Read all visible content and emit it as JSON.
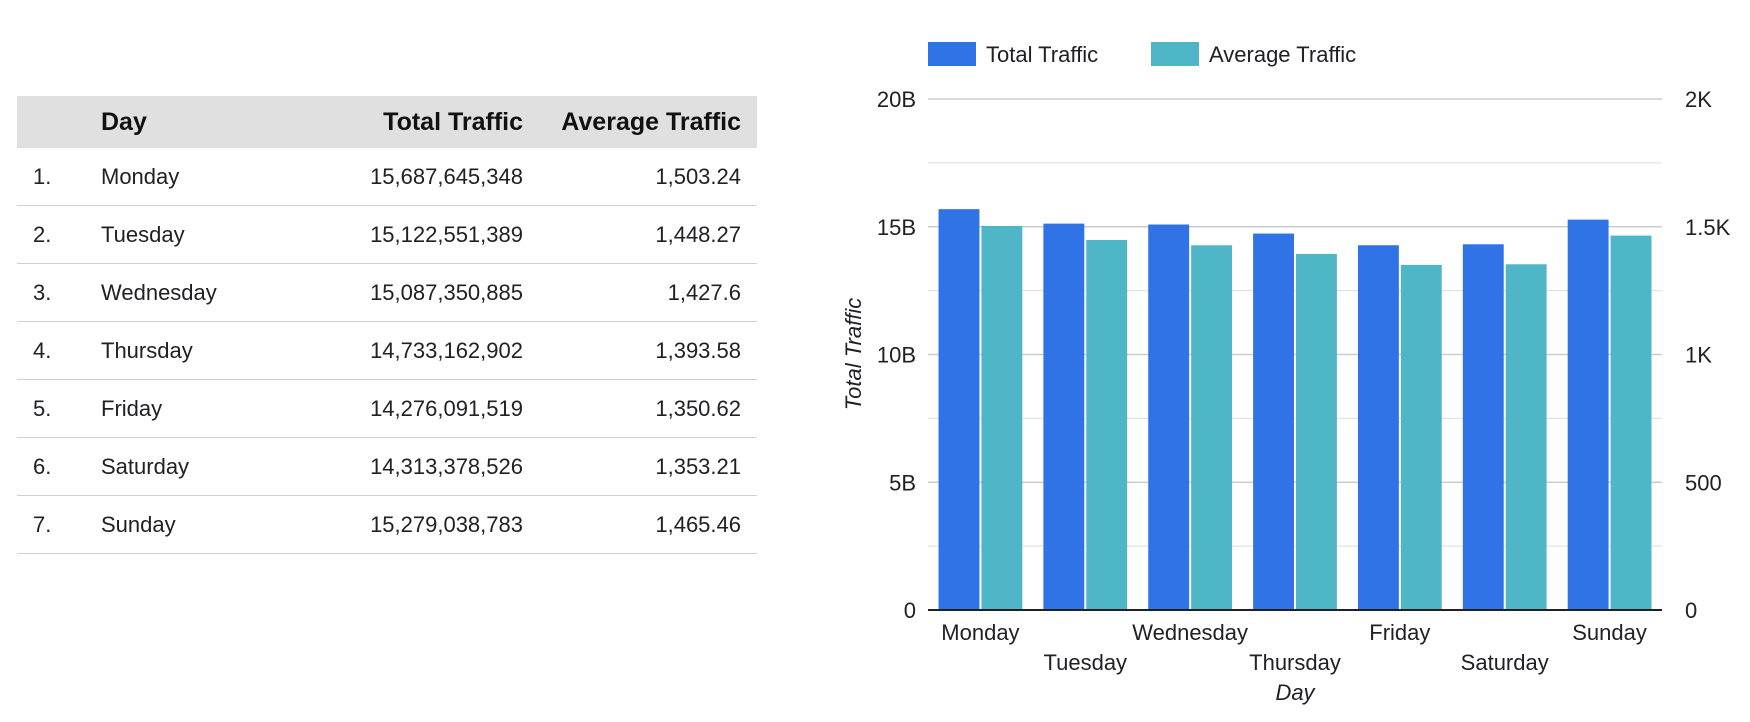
{
  "table": {
    "headers": {
      "index": "",
      "day": "Day",
      "total": "Total Traffic",
      "average": "Average Traffic"
    },
    "rows": [
      {
        "index": "1.",
        "day": "Monday",
        "total": "15,687,645,348",
        "average": "1,503.24"
      },
      {
        "index": "2.",
        "day": "Tuesday",
        "total": "15,122,551,389",
        "average": "1,448.27"
      },
      {
        "index": "3.",
        "day": "Wednesday",
        "total": "15,087,350,885",
        "average": "1,427.6"
      },
      {
        "index": "4.",
        "day": "Thursday",
        "total": "14,733,162,902",
        "average": "1,393.58"
      },
      {
        "index": "5.",
        "day": "Friday",
        "total": "14,276,091,519",
        "average": "1,350.62"
      },
      {
        "index": "6.",
        "day": "Saturday",
        "total": "14,313,378,526",
        "average": "1,353.21"
      },
      {
        "index": "7.",
        "day": "Sunday",
        "total": "15,279,038,783",
        "average": "1,465.46"
      }
    ]
  },
  "chart_data": {
    "type": "bar",
    "categories": [
      "Monday",
      "Tuesday",
      "Wednesday",
      "Thursday",
      "Friday",
      "Saturday",
      "Sunday"
    ],
    "series": [
      {
        "name": "Total Traffic",
        "axis": "left",
        "color": "#2f73e6",
        "values": [
          15687645348,
          15122551389,
          15087350885,
          14733162902,
          14276091519,
          14313378526,
          15279038783
        ]
      },
      {
        "name": "Average Traffic",
        "axis": "right",
        "color": "#4fb6c8",
        "values": [
          1503.24,
          1448.27,
          1427.6,
          1393.58,
          1350.62,
          1353.21,
          1465.46
        ]
      }
    ],
    "xlabel": "Day",
    "ylabel": "Total Traffic",
    "y_left": {
      "min": 0,
      "max": 20000000000,
      "ticks": [
        0,
        5000000000,
        10000000000,
        15000000000,
        20000000000
      ],
      "tick_labels": [
        "0",
        "5B",
        "10B",
        "15B",
        "20B"
      ]
    },
    "y_right": {
      "min": 0,
      "max": 2000,
      "ticks": [
        0,
        500,
        1000,
        1500,
        2000
      ],
      "tick_labels": [
        "0",
        "500",
        "1K",
        "1.5K",
        "2K"
      ]
    },
    "grid": true,
    "legend_position": "top-left"
  }
}
